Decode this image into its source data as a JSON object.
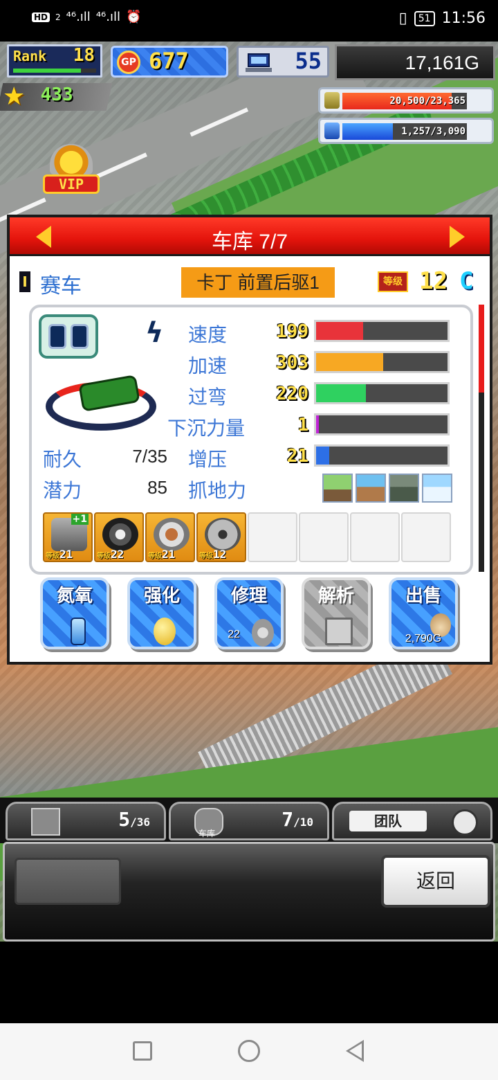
{
  "status_bar": {
    "hd": "HD",
    "sim_small": "2",
    "signal1": "⁴⁶.ıll",
    "signal2": "⁴⁶.ıll",
    "alarm": "⏰",
    "vibrate": "▯",
    "battery": "51",
    "time": "11:56"
  },
  "hud": {
    "rank_label": "Rank",
    "rank_value": "18",
    "rank_progress": 0.82,
    "gp_coin": "GP",
    "gp_value": "677",
    "pc_value": "55",
    "money": "17,161G",
    "stars": "433",
    "resource1": "20,500/23,365",
    "resource1_fill": 0.877,
    "resource2": "1,257/3,090",
    "resource2_fill": 0.407
  },
  "scene": {
    "vip_label": "VIP"
  },
  "garage": {
    "title": "车库 7/7",
    "roman": "I",
    "category": "赛车",
    "car_name": "卡丁 前置后驱1",
    "level_badge": "等级",
    "level": "12",
    "grade": "C",
    "stats": [
      {
        "label": "速度",
        "value": "199",
        "fill": 0.36,
        "color": "#e8333a"
      },
      {
        "label": "加速",
        "value": "303",
        "fill": 0.51,
        "color": "#f7a823"
      },
      {
        "label": "过弯",
        "value": "220",
        "fill": 0.38,
        "color": "#2fd160"
      },
      {
        "label": "下沉力量",
        "value": "1",
        "fill": 0.02,
        "color": "#c023d6"
      },
      {
        "label": "增压",
        "value": "21",
        "fill": 0.1,
        "color": "#2d6fe6"
      }
    ],
    "durability_label": "耐久",
    "durability_value": "7/35",
    "potential_label": "潜力",
    "potential_value": "85",
    "grip_label": "抓地力",
    "parts": [
      {
        "level_prefix": "等级",
        "level": "21",
        "plus": "+1"
      },
      {
        "level_prefix": "等级",
        "level": "22",
        "plus": ""
      },
      {
        "level_prefix": "等级",
        "level": "21",
        "plus": ""
      },
      {
        "level_prefix": "等级",
        "level": "12",
        "plus": ""
      }
    ],
    "scroll_position": 0.33,
    "actions": [
      {
        "label": "氮氧",
        "sub": ""
      },
      {
        "label": "强化",
        "sub": ""
      },
      {
        "label": "修理",
        "sub": "22"
      },
      {
        "label": "解析",
        "sub": ""
      },
      {
        "label": "出售",
        "sub": "2,790G"
      }
    ]
  },
  "bottom_tabs": {
    "parts_count": "5",
    "parts_total": "/36",
    "garage_label": "车库",
    "garage_count": "7",
    "garage_total": "/10",
    "team_label": "团队"
  },
  "back_button": "返回"
}
